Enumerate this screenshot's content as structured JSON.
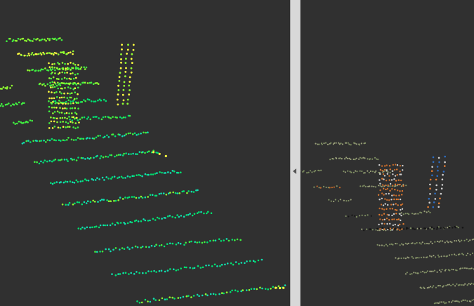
{
  "app": {
    "title": "",
    "view_mode": "split"
  },
  "left_view": {
    "kind": "point-cloud",
    "colormap": "height",
    "background": "#303030",
    "palette": [
      "#00e070",
      "#10e0b0",
      "#40f040",
      "#90ff30",
      "#ffff40"
    ]
  },
  "right_view": {
    "kind": "point-cloud",
    "colormap": "rgb",
    "background": "#303030",
    "palette": [
      "#7f8f62",
      "#9aa07a",
      "#c56a2a",
      "#e07a30",
      "#cfcfcf",
      "#2d6cc0",
      "#151515"
    ]
  },
  "splitter": {
    "icon": "chevron-left-icon"
  }
}
